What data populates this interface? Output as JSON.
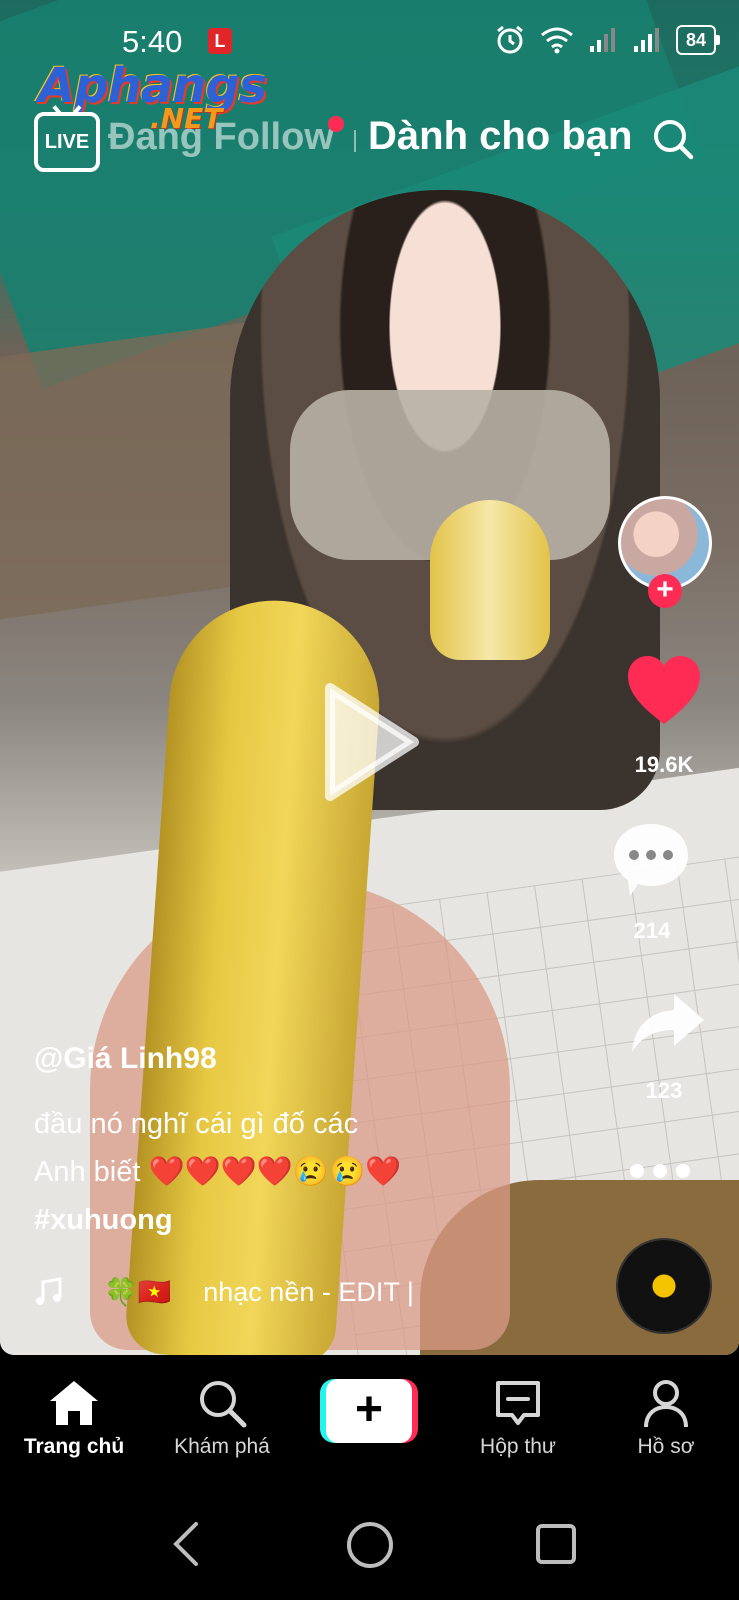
{
  "status_bar": {
    "time": "5:40",
    "carrier_badge": "L",
    "battery": "84"
  },
  "watermark": {
    "main": "Aphangs",
    "sub": ".NET"
  },
  "top_nav": {
    "live_label": "LIVE",
    "following_label": "Đang Follow",
    "for_you_label": "Dành cho bạn"
  },
  "video": {
    "username": "@Giá Linh98",
    "description_lines": [
      "đầu nó nghĩ cái gì đố các",
      "Anh biết ❤️❤️❤️❤️😢😢❤️",
      "#xuhuong"
    ],
    "music_emojis": "🍀🇻🇳",
    "music_title": "nhạc nền - EDIT |",
    "like_count": "19.6K",
    "comment_count": "214",
    "share_count": "123"
  },
  "bottom_nav": {
    "home": "Trang chủ",
    "explore": "Khám phá",
    "inbox": "Hộp thư",
    "profile": "Hồ sơ",
    "create_symbol": "+"
  },
  "colors": {
    "accent_red": "#fe2c55",
    "accent_cyan": "#25f4ee",
    "background": "#000000"
  },
  "icons": [
    "live-icon",
    "search-icon",
    "plus-icon",
    "heart-icon",
    "comment-icon",
    "share-icon",
    "more-icon",
    "music-disc-icon",
    "music-note-icon",
    "play-icon",
    "home-icon",
    "explore-icon",
    "inbox-icon",
    "profile-icon",
    "back-icon",
    "home-circle-icon",
    "recent-apps-icon",
    "wifi-icon",
    "signal-icon",
    "alarm-icon"
  ]
}
